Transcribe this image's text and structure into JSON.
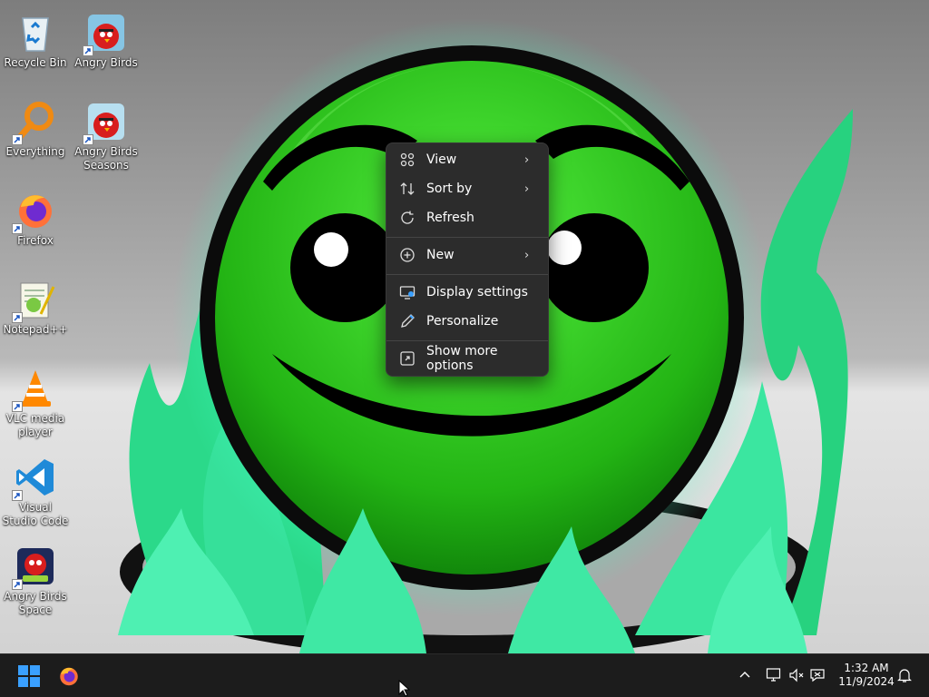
{
  "desktop": {
    "icons": [
      {
        "label": "Recycle Bin",
        "icon": "recycle-bin-icon"
      },
      {
        "label": "Angry Birds",
        "icon": "angry-birds-icon"
      },
      {
        "label": "Everything",
        "icon": "everything-search-icon"
      },
      {
        "label": "Angry Birds Seasons",
        "icon": "angry-birds-seasons-icon"
      },
      {
        "label": "Firefox",
        "icon": "firefox-icon"
      },
      {
        "label": "Notepad++",
        "icon": "notepad-plus-plus-icon"
      },
      {
        "label": "VLC media player",
        "icon": "vlc-icon"
      },
      {
        "label": "Visual Studio Code",
        "icon": "vscode-icon"
      },
      {
        "label": "Angry Birds Space",
        "icon": "angry-birds-space-icon"
      }
    ]
  },
  "context_menu": {
    "items": [
      {
        "label": "View",
        "icon": "grid-view-icon",
        "submenu": true
      },
      {
        "label": "Sort by",
        "icon": "sort-arrows-icon",
        "submenu": true
      },
      {
        "label": "Refresh",
        "icon": "refresh-icon",
        "submenu": false
      },
      {
        "label": "New",
        "icon": "plus-circle-icon",
        "submenu": true
      },
      {
        "label": "Display settings",
        "icon": "display-settings-icon",
        "submenu": false
      },
      {
        "label": "Personalize",
        "icon": "pen-icon",
        "submenu": false
      },
      {
        "label": "Show more options",
        "icon": "expand-icon",
        "submenu": false
      }
    ],
    "chevron": "›"
  },
  "taskbar": {
    "pinned": [
      "windows-start-icon",
      "firefox-icon"
    ],
    "tray": [
      "chevron-up-icon",
      "network-icon",
      "speaker-muted-icon",
      "speech-bubble-icon"
    ],
    "time": "1:32 AM",
    "date": "11/9/2024"
  },
  "colors": {
    "accent": "#20e060",
    "menu_bg": "#2c2c2c",
    "taskbar_bg": "#1c1c1c",
    "windows_blue": "#3aa0ff"
  }
}
